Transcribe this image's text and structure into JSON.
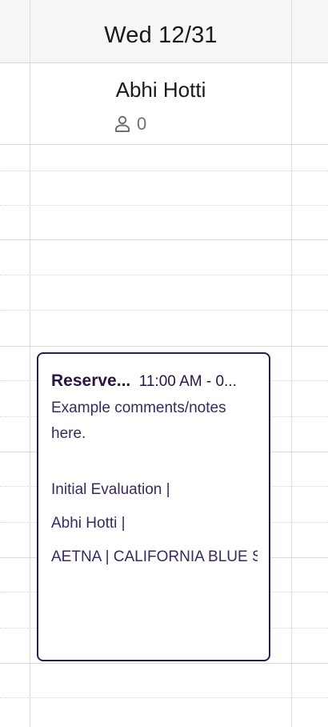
{
  "header": {
    "day_title": "Wed 12/31"
  },
  "provider": {
    "name": "Abhi Hotti",
    "count": "0"
  },
  "appointment": {
    "title": "Reserve...",
    "time": "11:00 AM - 0...",
    "notes": "Example comments/notes here.",
    "visit_type": "Initial Evaluation  |",
    "provider": "Abhi Hotti  |",
    "insurance": "AETNA  |  CALIFORNIA BLUE SHIELD",
    "border_color": "#2d1a4f"
  }
}
